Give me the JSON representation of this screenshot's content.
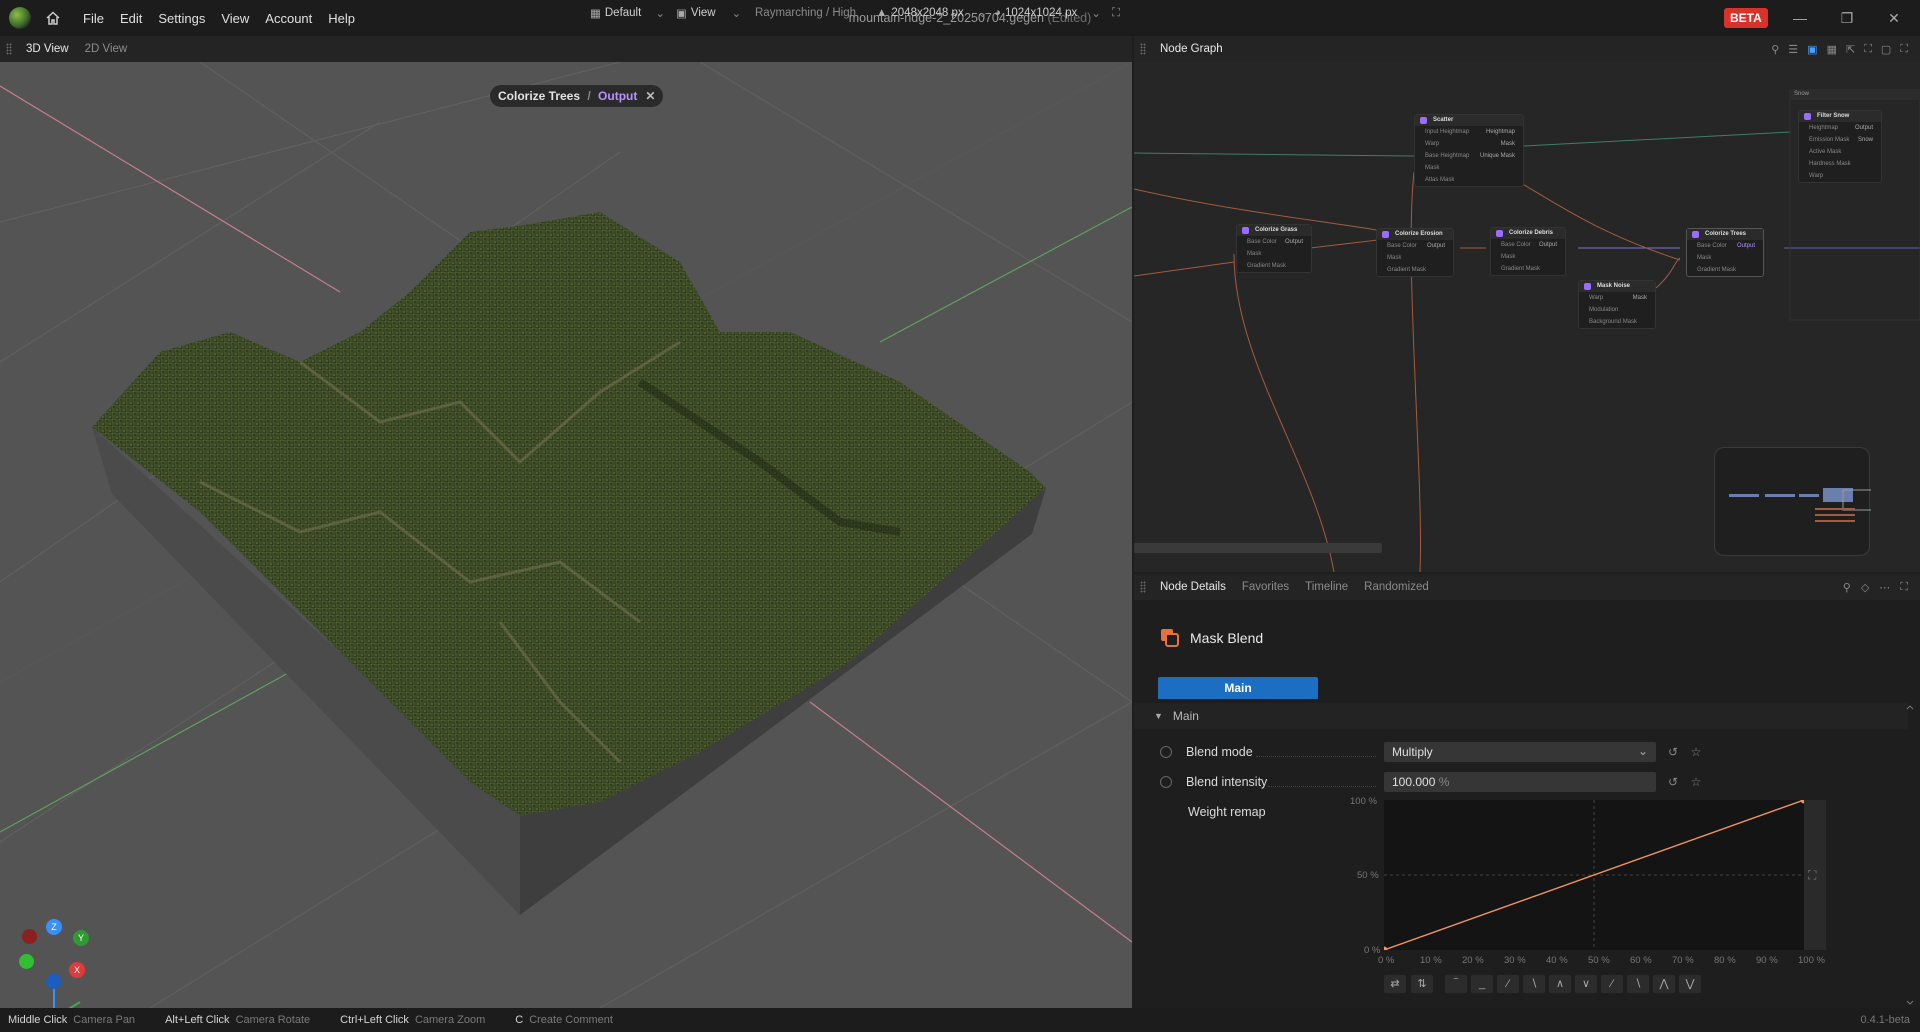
{
  "app": {
    "menu": [
      "File",
      "Edit",
      "Settings",
      "View",
      "Account",
      "Help"
    ],
    "file_name": "mountain-ridge-2_20250704.gegen",
    "file_state": "(Edited)",
    "beta_badge": "BETA"
  },
  "view3d": {
    "tabs": [
      "3D View",
      "2D View"
    ],
    "active_tab": "3D View",
    "layout_preset": "Default",
    "view_menu": "View",
    "render_mode": "Raymarching / High",
    "heightmap_resolution": "2048x2048 px",
    "texture_resolution": "1024x1024 px",
    "preview_node": "Colorize Trees",
    "preview_separator": " / ",
    "preview_output": "Output",
    "gizmo_labels": {
      "z": "Z",
      "y": "Y",
      "x": "X"
    }
  },
  "node_graph": {
    "title": "Node Graph",
    "group_label": "Snow",
    "nodes": [
      {
        "title": "Scatter",
        "rows": [
          [
            "Input Heightmap",
            "Heightmap"
          ],
          [
            "Warp",
            "Mask"
          ],
          [
            "Base Heightmap",
            "Unique Mask"
          ],
          [
            "Mask",
            ""
          ],
          [
            "Atlas Mask",
            ""
          ]
        ]
      },
      {
        "title": "Filter Snow",
        "rows": [
          [
            "Heightmap",
            "Output"
          ],
          [
            "Emission Mask",
            "Snow"
          ],
          [
            "Active Mask",
            ""
          ],
          [
            "Hardness Mask",
            ""
          ],
          [
            "Warp",
            ""
          ]
        ]
      },
      {
        "title": "Colorize Grass",
        "rows": [
          [
            "Base Color",
            "Output"
          ],
          [
            "Mask",
            ""
          ],
          [
            "Gradient Mask",
            ""
          ]
        ]
      },
      {
        "title": "Colorize Erosion",
        "rows": [
          [
            "Base Color",
            "Output"
          ],
          [
            "Mask",
            ""
          ],
          [
            "Gradient Mask",
            ""
          ]
        ]
      },
      {
        "title": "Colorize Debris",
        "rows": [
          [
            "Base Color",
            "Output"
          ],
          [
            "Mask",
            ""
          ],
          [
            "Gradient Mask",
            ""
          ]
        ]
      },
      {
        "title": "Colorize Trees",
        "rows": [
          [
            "Base Color",
            "Output"
          ],
          [
            "Mask",
            ""
          ],
          [
            "Gradient Mask",
            ""
          ]
        ]
      },
      {
        "title": "Mask Noise",
        "rows": [
          [
            "Warp",
            "Mask"
          ],
          [
            "Modulation",
            ""
          ],
          [
            "Background Mask",
            ""
          ]
        ]
      }
    ]
  },
  "node_details": {
    "tabs": [
      "Node Details",
      "Favorites",
      "Timeline",
      "Randomized"
    ],
    "active_tab": "Node Details",
    "node_name": "Mask Blend",
    "main_tab": "Main",
    "section": "Main",
    "params": {
      "blend_mode_label": "Blend mode",
      "blend_mode_value": "Multiply",
      "blend_intensity_label": "Blend intensity",
      "blend_intensity_value": "100.000",
      "blend_intensity_unit": "%",
      "weight_remap_label": "Weight remap"
    },
    "remap_y_ticks": [
      "100 %",
      "50 %",
      "0 %"
    ],
    "remap_x_ticks": [
      "0 %",
      "10 %",
      "20 %",
      "30 %",
      "40 %",
      "50 %",
      "60 %",
      "70 %",
      "80 %",
      "90 %",
      "100 %"
    ],
    "remap_curve": {
      "points": [
        [
          0,
          0
        ],
        [
          100,
          100
        ]
      ]
    }
  },
  "status": {
    "hints": [
      {
        "key": "Middle Click",
        "desc": "Camera Pan"
      },
      {
        "key": "Alt+Left Click",
        "desc": "Camera Rotate"
      },
      {
        "key": "Ctrl+Left Click",
        "desc": "Camera Zoom"
      },
      {
        "key": "C",
        "desc": "Create Comment"
      }
    ],
    "version": "0.4.1-beta"
  },
  "colors": {
    "accent": "#1b6ec2",
    "beta": "#d9322b",
    "output_purple": "#b792ff",
    "curve": "#f0935c"
  }
}
